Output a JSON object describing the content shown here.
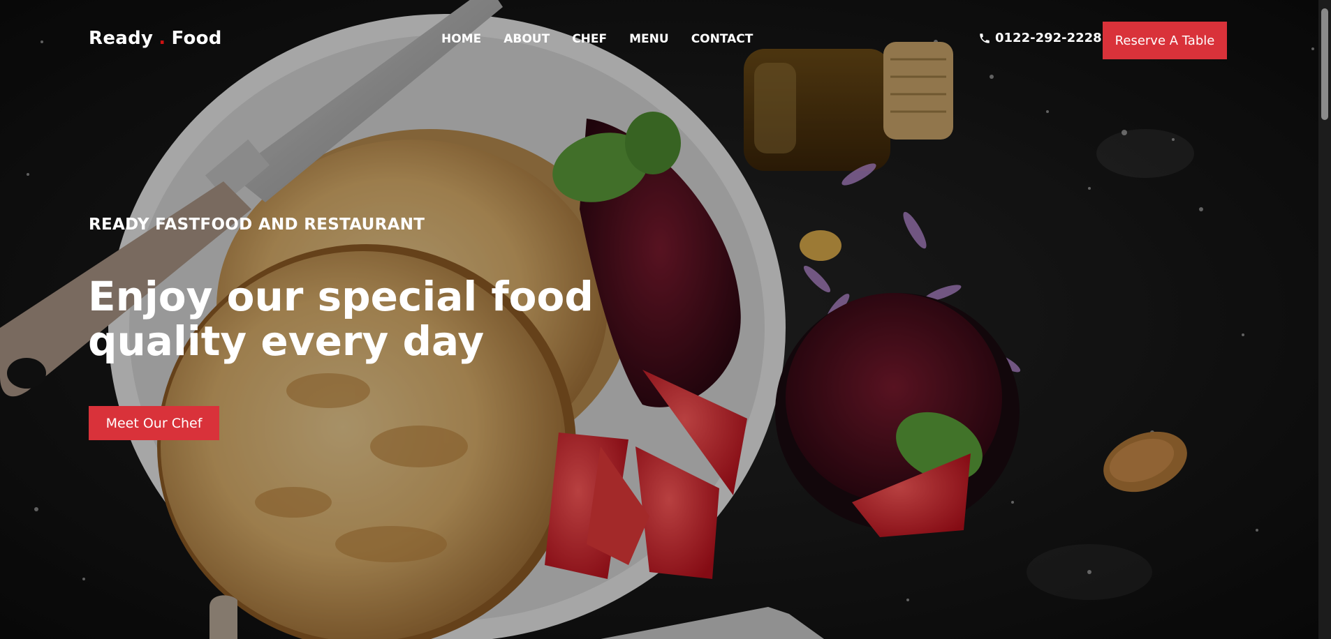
{
  "brand": {
    "part1": "Ready",
    "dot": ".",
    "part2": "Food"
  },
  "nav": {
    "items": [
      {
        "label": "HOME"
      },
      {
        "label": "ABOUT"
      },
      {
        "label": "CHEF"
      },
      {
        "label": "MENU"
      },
      {
        "label": "CONTACT"
      }
    ],
    "phone": "0122-292-2228",
    "phone_icon": "phone-icon",
    "reserve_label": "Reserve A Table"
  },
  "hero": {
    "subtitle": "READY FASTFOOD AND RESTAURANT",
    "headline": "Enjoy our special food quality every day",
    "cta_label": "Meet Our Chef"
  },
  "colors": {
    "accent": "#d9323a",
    "brand_dot": "#ce1212",
    "text": "#ffffff",
    "background": "#0c0c0c"
  }
}
